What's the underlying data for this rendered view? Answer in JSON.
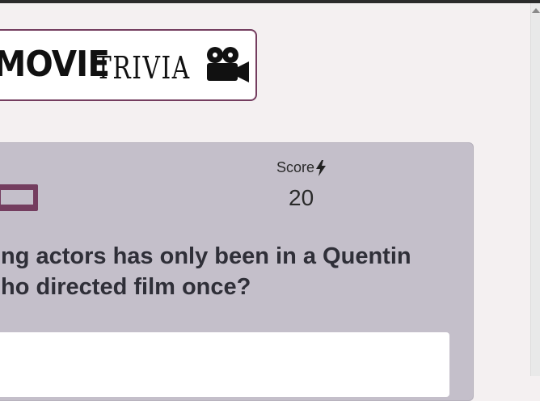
{
  "logo": {
    "word1": "MOVIE",
    "word2": "TRIVIA",
    "icon": "film-camera-icon"
  },
  "score": {
    "label": "Score",
    "icon": "lightning-bolt-icon",
    "value": "20"
  },
  "question": {
    "line1": "ng actors has only been in a Quentin",
    "line2": "ho directed film once?"
  },
  "colors": {
    "accent": "#743d5f",
    "card_background": "#c4bfca",
    "page_background": "#f4f0f1"
  }
}
